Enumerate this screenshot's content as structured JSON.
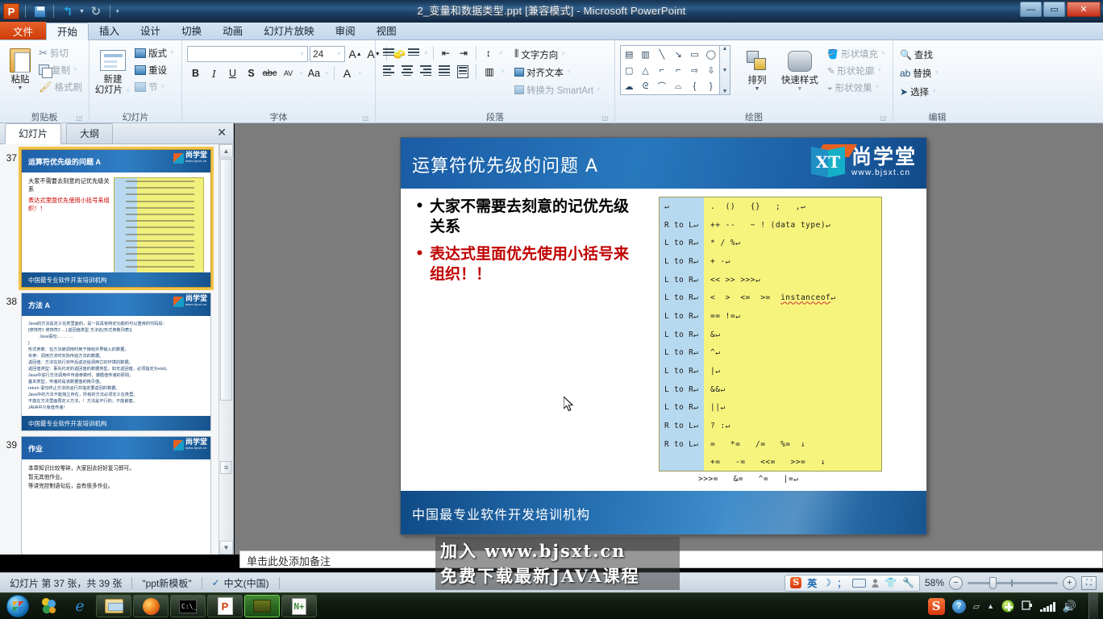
{
  "window": {
    "title": "2_变量和数据类型.ppt [兼容模式]  -  Microsoft PowerPoint",
    "app_icon": "P",
    "minimize": "—",
    "maximize": "▭",
    "close": "✕"
  },
  "quick_access": {
    "save": "save-icon",
    "undo": "↺",
    "redo": "↻",
    "more": "▾"
  },
  "ribbon_tabs": [
    {
      "label": "文件",
      "active": false,
      "file": true
    },
    {
      "label": "开始",
      "active": true
    },
    {
      "label": "插入",
      "active": false
    },
    {
      "label": "设计",
      "active": false
    },
    {
      "label": "切换",
      "active": false
    },
    {
      "label": "动画",
      "active": false
    },
    {
      "label": "幻灯片放映",
      "active": false
    },
    {
      "label": "审阅",
      "active": false
    },
    {
      "label": "视图",
      "active": false
    }
  ],
  "ribbon": {
    "clipboard": {
      "group_label": "剪贴板",
      "paste": "粘贴",
      "cut": "剪切",
      "copy": "复制",
      "format_painter": "格式刷"
    },
    "slides": {
      "group_label": "幻灯片",
      "new_slide_line1": "新建",
      "new_slide_line2": "幻灯片",
      "layout": "版式",
      "reset": "重设",
      "section": "节"
    },
    "font": {
      "group_label": "字体",
      "font_name": "",
      "font_size": "24",
      "grow": "A",
      "shrink": "A",
      "clear_format": "Aa",
      "bold": "B",
      "italic": "I",
      "underline": "U",
      "shadow": "S",
      "strike": "abc",
      "spacing": "AV",
      "case": "Aa",
      "color": "A"
    },
    "paragraph": {
      "group_label": "段落",
      "text_direction": "文字方向",
      "align_text": "对齐文本",
      "convert_smartart": "转换为 SmartArt"
    },
    "drawing": {
      "group_label": "绘图",
      "arrange": "排列",
      "quick_styles": "快速样式",
      "shape_fill": "形状填充",
      "shape_outline": "形状轮廓",
      "shape_effects": "形状效果"
    },
    "editing": {
      "group_label": "编辑",
      "find": "查找",
      "replace": "替换",
      "select": "选择"
    }
  },
  "left_pane": {
    "tabs": [
      {
        "label": "幻灯片",
        "active": true
      },
      {
        "label": "大纲",
        "active": false
      }
    ],
    "close": "✕",
    "thumbnails": [
      {
        "number": "37",
        "title": "运算符优先级的问题 A",
        "footer": "中国最专业软件开发培训机构",
        "selected": true,
        "bullets": [
          {
            "text": "大家不需要去刻意的记优先级关系",
            "color": "black"
          },
          {
            "text": "表达式里面优先使用小括号来组织！！",
            "color": "red"
          }
        ],
        "has_table": true
      },
      {
        "number": "38",
        "title": "方法 A",
        "footer": "中国最专业软件开发培训机构",
        "selected": false,
        "small_lines": [
          "Java的方法是定义在类里面的，是一段具有特定功能的可以重用的代码段：",
          "[修饰符1 修饰符2 …] 返回值类型  方法名(形式参数列表){",
          "      Java语句;… … …",
          "}",
          "形式参数：在方法被调用时用于接收外界输入的数据。",
          "实参：调用方法时实际传给方法的数据。",
          "返回值：方法在执行完毕后返还给调用它的环境的数据。",
          "返回值类型：事先约定的返回值的数据类型，如无返回值，必须指定为void。",
          "Java中进行方法调用中传递参数时，遵循值传递的原则。",
          "基本类型，传递的是该数据值的拷贝值。",
          "return 语句终止方法的运行并指定要返回的数据。",
          "Java中的方法不能独立存在，所有的方法必须定义在类里。",
          "    不能在方法里面再定义方法，！方法是平行的，不能嵌套。",
          "JAVA中只有值传递！"
        ]
      },
      {
        "number": "39",
        "title": "作业",
        "footer": "",
        "selected": false,
        "bullets_small": [
          "本章知识比较零碎，大家回去好好复习即可。",
          "暂无其他作业。",
          "等讲完控制语句后，会有很多作业。"
        ]
      }
    ],
    "scroll_up": "▲",
    "scroll_down": "▼",
    "scroll_grip": "≡"
  },
  "slide": {
    "title": "运算符优先级的问题  A",
    "logo_text": "尚学堂",
    "logo_url": "www.bjsxt.cn",
    "logo_cube": "XT",
    "bullets": [
      {
        "marker": "•",
        "text": "大家不需要去刻意的记优先级关系",
        "color": "black"
      },
      {
        "marker": "•",
        "text": "表达式里面优先使用小括号来组织！！",
        "color": "red"
      }
    ],
    "footer": "中国最专业软件开发培训机构",
    "operator_table": {
      "rows": [
        {
          "assoc": "↵",
          "ops": ".  ()   {}   ;   ,↵"
        },
        {
          "assoc": "R to L↵",
          "ops": "++ --   ~ ! (data type)↵"
        },
        {
          "assoc": "L to R↵",
          "ops": "* / %↵"
        },
        {
          "assoc": "L to R↵",
          "ops": "+ -↵"
        },
        {
          "assoc": "L to R↵",
          "ops": "<< >> >>>↵"
        },
        {
          "assoc": "L to R↵",
          "ops": "<  >  <=  >=  ",
          "underlined": "instanceof",
          "ops_tail": "↵"
        },
        {
          "assoc": "L to R↵",
          "ops": "== !=↵"
        },
        {
          "assoc": "L to R↵",
          "ops": "&↵"
        },
        {
          "assoc": "L to R↵",
          "ops": "^↵"
        },
        {
          "assoc": "L to R↵",
          "ops": "|↵"
        },
        {
          "assoc": "L to R↵",
          "ops": "&&↵"
        },
        {
          "assoc": "L to R↵",
          "ops": "||↵"
        },
        {
          "assoc": "R to L↵",
          "ops": "? :↵"
        },
        {
          "assoc": "R to L↵",
          "ops": "=   *=   /=   %=  ↓"
        }
      ],
      "continuation": [
        "+=   -=   <<=   >>=   ↓",
        ">>>=   &=   ^=   |=↵"
      ]
    }
  },
  "notes": {
    "placeholder": "单击此处添加备注"
  },
  "status_bar": {
    "slide_count": "幻灯片 第 37 张，共 39 张",
    "theme": "\"ppt新模板\"",
    "language": "中文(中国)",
    "zoom": "58%",
    "zoom_out": "−",
    "zoom_in": "+",
    "fit_window": "⛶",
    "ime": {
      "logo": "S",
      "mode": "英",
      "moon": "☽",
      "punct": "；",
      "keyboard": "keyboard-icon",
      "person": "person-icon",
      "shirt": "👕",
      "wrench": "🔧"
    }
  },
  "watermark": {
    "line1": "加入  www.bjsxt.cn",
    "line2": "免费下载最新JAVA课程"
  },
  "taskbar": {
    "start": "start-orb",
    "pinned": [
      {
        "name": "sogou",
        "label": "搜狗"
      },
      {
        "name": "internet-explorer",
        "label": "Internet Explorer"
      },
      {
        "name": "windows-explorer",
        "label": "资源管理器"
      }
    ],
    "running": [
      {
        "name": "firefox",
        "label": "Firefox",
        "active": false
      },
      {
        "name": "command-prompt",
        "label": "命令提示符",
        "active": false
      },
      {
        "name": "powerpoint",
        "label": "PowerPoint",
        "active": false
      },
      {
        "name": "camtasia-recorder",
        "label": "录屏",
        "active": true
      },
      {
        "name": "notepad-plus-plus",
        "label": "Notepad++",
        "active": false
      }
    ],
    "tray": {
      "sogou": "S",
      "help": "?",
      "windows": "▱",
      "expand": "▲",
      "update": "✚",
      "power": "power-icon",
      "network": "signal-icon",
      "volume": "🔊"
    }
  }
}
